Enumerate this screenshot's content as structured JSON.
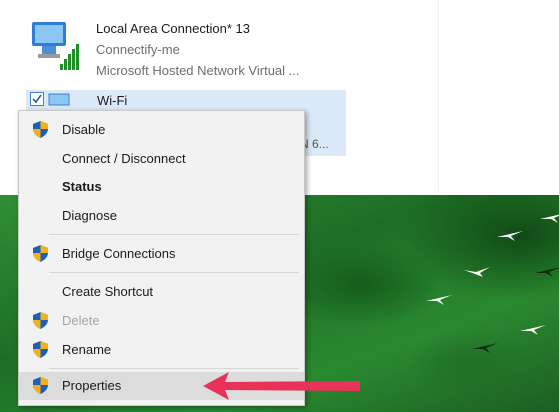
{
  "adapters": [
    {
      "name": "Local Area Connection* 13",
      "network": "Connectify-me",
      "device": "Microsoft Hosted Network Virtual ..."
    }
  ],
  "wifi": {
    "name": "Wi-Fi",
    "device_truncated": "N 6..."
  },
  "menu": {
    "items": [
      {
        "label": "Disable",
        "shield": true
      },
      {
        "label": "Connect / Disconnect",
        "shield": false
      },
      {
        "label": "Status",
        "shield": false,
        "bold": true
      },
      {
        "label": "Diagnose",
        "shield": false
      },
      {
        "label": "Bridge Connections",
        "shield": true
      },
      {
        "label": "Create Shortcut",
        "shield": false
      },
      {
        "label": "Delete",
        "shield": true,
        "disabled": true
      },
      {
        "label": "Rename",
        "shield": true
      },
      {
        "label": "Properties",
        "shield": true,
        "highlighted": true
      }
    ]
  },
  "colors": {
    "accent_arrow": "#e8325a",
    "selection": "#dbe9f8",
    "shield_blue": "#1f5fb3",
    "shield_gold": "#f2b21b"
  },
  "icons": {
    "adapter": "network-adapter-icon",
    "signal": "signal-bars-icon",
    "shield": "uac-shield-icon"
  }
}
